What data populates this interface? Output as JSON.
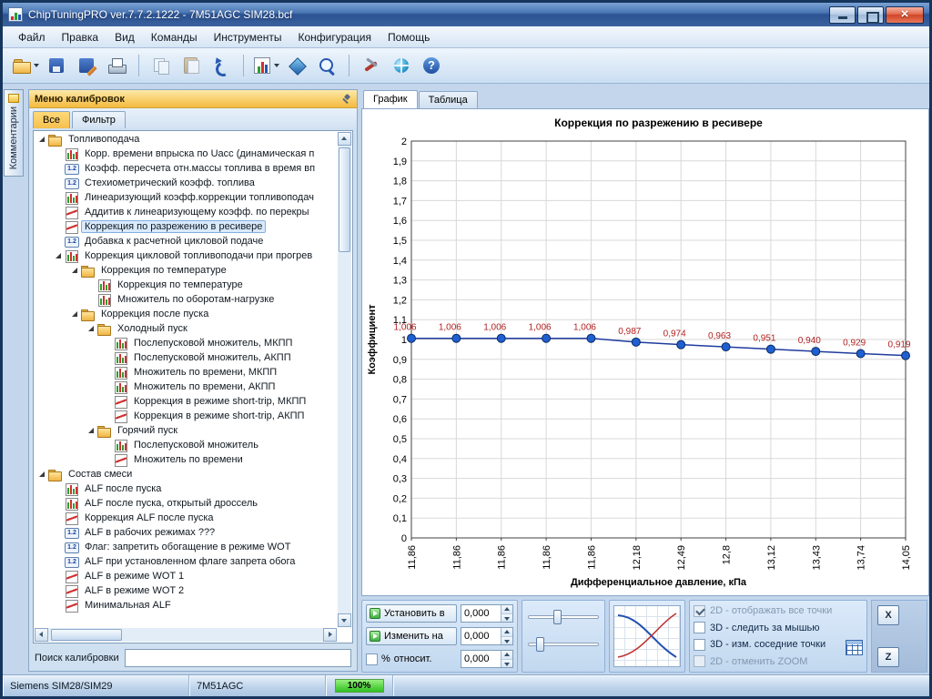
{
  "window": {
    "title": "ChipTuningPRO ver.7.7.2.1222 - 7M51AGC SIM28.bcf",
    "controls": [
      "minimize",
      "maximize",
      "close"
    ]
  },
  "menu": {
    "items": [
      "Файл",
      "Правка",
      "Вид",
      "Команды",
      "Инструменты",
      "Конфигурация",
      "Помощь"
    ]
  },
  "toolbar": {
    "buttons": [
      "open-file",
      "save",
      "save-as",
      "print",
      "copy",
      "paste",
      "undo",
      "chart-select",
      "navigate",
      "zoom",
      "tools",
      "online",
      "help"
    ]
  },
  "side_tab": {
    "label": "Комментарии"
  },
  "calibration_panel": {
    "title": "Меню калибровок",
    "tabs": [
      "Все",
      "Фильтр"
    ],
    "search_label": "Поиск калибровки",
    "tree": [
      {
        "label": "Топливоподача",
        "icon": "ic-folder",
        "cls": "d0 exp"
      },
      {
        "label": "Корр. времени впрыска по Uacc (динамическая п",
        "icon": "ic-chart",
        "cls": "d1"
      },
      {
        "label": "Коэфф. пересчета отн.массы топлива в время вп",
        "icon": "ic-num",
        "cls": "d1"
      },
      {
        "label": "Стехиометрический коэфф. топлива",
        "icon": "ic-num",
        "cls": "d1"
      },
      {
        "label": "Линеаризующий коэфф.коррекции топливоподач",
        "icon": "ic-chart",
        "cls": "d1"
      },
      {
        "label": "Аддитив к линеаризующему коэфф. по перекры",
        "icon": "ic-curve",
        "cls": "d1"
      },
      {
        "label": "Коррекция по разрежению в ресивере",
        "icon": "ic-curve",
        "cls": "d1 sel"
      },
      {
        "label": "Добавка к расчетной цикловой подаче",
        "icon": "ic-num",
        "cls": "d1"
      },
      {
        "label": "Коррекция цикловой топливоподачи при прогрев",
        "icon": "ic-chart",
        "cls": "d1 exp"
      },
      {
        "label": "Коррекция по температуре",
        "icon": "ic-folder",
        "cls": "d2 exp"
      },
      {
        "label": "Коррекция по температуре",
        "icon": "ic-chart",
        "cls": "d3"
      },
      {
        "label": "Множитель по оборотам-нагрузке",
        "icon": "ic-chart",
        "cls": "d3"
      },
      {
        "label": "Коррекция после пуска",
        "icon": "ic-folder",
        "cls": "d2 exp"
      },
      {
        "label": "Холодный пуск",
        "icon": "ic-folder",
        "cls": "d3 exp"
      },
      {
        "label": "Послепусковой множитель, МКПП",
        "icon": "ic-chart",
        "cls": "d4"
      },
      {
        "label": "Послепусковой множитель, АКПП",
        "icon": "ic-chart",
        "cls": "d4"
      },
      {
        "label": "Множитель по времени, МКПП",
        "icon": "ic-chart",
        "cls": "d4"
      },
      {
        "label": "Множитель по времени, АКПП",
        "icon": "ic-chart",
        "cls": "d4"
      },
      {
        "label": "Коррекция в режиме short-trip, МКПП",
        "icon": "ic-curve",
        "cls": "d4"
      },
      {
        "label": "Коррекция в режиме short-trip, АКПП",
        "icon": "ic-curve",
        "cls": "d4"
      },
      {
        "label": "Горячий пуск",
        "icon": "ic-folder",
        "cls": "d3 exp"
      },
      {
        "label": "Послепусковой множитель",
        "icon": "ic-chart",
        "cls": "d4"
      },
      {
        "label": "Множитель по времени",
        "icon": "ic-curve",
        "cls": "d4"
      },
      {
        "label": "Состав смеси",
        "icon": "ic-folder",
        "cls": "d0 exp"
      },
      {
        "label": "ALF после пуска",
        "icon": "ic-chart",
        "cls": "d1"
      },
      {
        "label": "ALF после пуска, открытый дроссель",
        "icon": "ic-chart",
        "cls": "d1"
      },
      {
        "label": "Коррекция ALF после пуска",
        "icon": "ic-curve",
        "cls": "d1"
      },
      {
        "label": "ALF в рабочих режимах ???",
        "icon": "ic-num",
        "cls": "d1"
      },
      {
        "label": "Флаг: запретить обогащение в режиме WOT",
        "icon": "ic-num",
        "cls": "d1"
      },
      {
        "label": "ALF при установленном флаге запрета обога",
        "icon": "ic-num",
        "cls": "d1"
      },
      {
        "label": "ALF в режиме WOT 1",
        "icon": "ic-curve",
        "cls": "d1"
      },
      {
        "label": "ALF в режиме WOT 2",
        "icon": "ic-curve",
        "cls": "d1"
      },
      {
        "label": "Минимальная ALF",
        "icon": "ic-curve",
        "cls": "d1"
      }
    ]
  },
  "main": {
    "tabs": [
      "График",
      "Таблица"
    ]
  },
  "chart_data": {
    "type": "line",
    "title": "Коррекция по разрежению в ресивере",
    "xlabel": "Дифференциальное давление, кПа",
    "ylabel": "Коэффициент",
    "categories": [
      "11,86",
      "11,86",
      "11,86",
      "11,86",
      "11,86",
      "12,18",
      "12,49",
      "12,8",
      "13,12",
      "13,43",
      "13,74",
      "14,05"
    ],
    "values": [
      1.006,
      1.006,
      1.006,
      1.006,
      1.006,
      0.987,
      0.974,
      0.963,
      0.951,
      0.94,
      0.929,
      0.919
    ],
    "point_labels": [
      "1,006",
      "1,006",
      "1,006",
      "1,006",
      "1,006",
      "0,987",
      "0,974",
      "0,963",
      "0,951",
      "0,940",
      "0,929",
      "0,919"
    ],
    "ylim": [
      0,
      2
    ],
    "ytick_step": 0.1,
    "grid": true,
    "legend": "none",
    "line_color": "#1f3c9e",
    "point_color": "#1f5fd0",
    "label_color": "#b22222"
  },
  "controls": {
    "set_to_label": "Установить в",
    "change_by_label": "Изменить на",
    "percent_label": "%",
    "relative_label": "относит.",
    "spin_values": [
      "0,000",
      "0,000",
      "0,000"
    ],
    "checkboxes": [
      {
        "label": "2D - отображать все точки",
        "box": "checked disabled",
        "cls": "disabled"
      },
      {
        "label": "3D - следить за мышью",
        "box": "",
        "cls": ""
      },
      {
        "label": "3D - изм. соседние точки",
        "box": "",
        "cls": ""
      },
      {
        "label": "2D - отменить ZOOM",
        "box": "disabled",
        "cls": "disabled"
      }
    ],
    "axis_buttons": [
      "X",
      "Z"
    ]
  },
  "statusbar": {
    "ecu": "Siemens SIM28/SIM29",
    "project": "7M51AGC",
    "progress": "100%"
  }
}
